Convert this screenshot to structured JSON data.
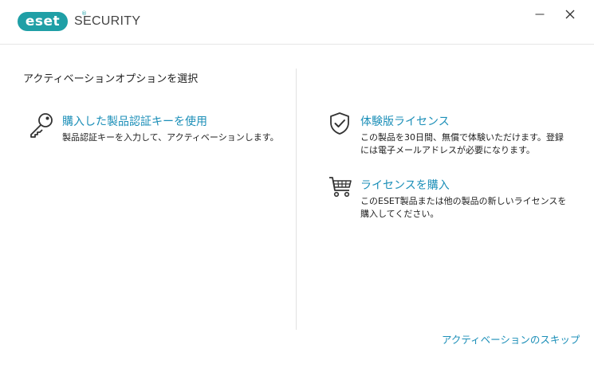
{
  "app": {
    "logo_text": "eset",
    "logo_reg": "®",
    "product": "SECURITY"
  },
  "window_controls": {
    "minimize": "─",
    "close": "✕"
  },
  "page": {
    "subtitle": "アクティベーションオプションを選択"
  },
  "options": {
    "license_key": {
      "icon": "key-icon",
      "title": "購入した製品認証キーを使用",
      "description": "製品認証キーを入力して、アクティベーションします。"
    },
    "trial": {
      "icon": "shield-check-icon",
      "title": "体験版ライセンス",
      "description": "この製品を30日間、無償で体験いただけます。登録には電子メールアドレスが必要になります。"
    },
    "buy": {
      "icon": "shopping-cart-icon",
      "title": "ライセンスを購入",
      "description": "このESET製品または他の製品の新しいライセンスを購入してください。"
    }
  },
  "footer": {
    "skip_link": "アクティベーションのスキップ"
  },
  "colors": {
    "brand": "#1f9fa6",
    "link": "#1c8fb8"
  }
}
